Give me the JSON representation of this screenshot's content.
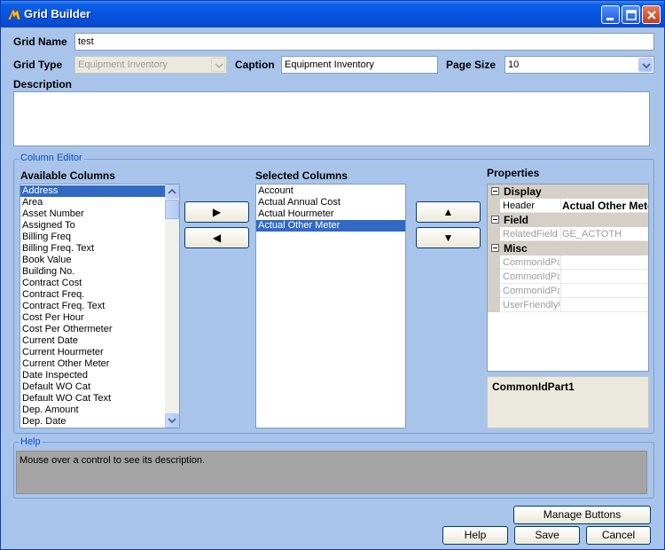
{
  "window": {
    "title": "Grid Builder"
  },
  "form": {
    "grid_name_label": "Grid Name",
    "grid_name_value": "test",
    "grid_type_label": "Grid Type",
    "grid_type_value": "Equipment Inventory",
    "caption_label": "Caption",
    "caption_value": "Equipment Inventory",
    "page_size_label": "Page Size",
    "page_size_value": "10",
    "description_label": "Description",
    "description_value": ""
  },
  "column_editor": {
    "title": "Column Editor",
    "available_label": "Available Columns",
    "available_columns": [
      "Address",
      "Area",
      "Asset Number",
      "Assigned To",
      "Billing Freq",
      "Billing Freq. Text",
      "Book Value",
      "Building No.",
      "Contract Cost",
      "Contract Freq.",
      "Contract Freq. Text",
      "Cost Per Hour",
      "Cost Per Othermeter",
      "Current Date",
      "Current Hourmeter",
      "Current Other Meter",
      "Date Inspected",
      "Default WO Cat",
      "Default WO Cat Text",
      "Dep. Amount",
      "Dep. Date"
    ],
    "available_selected_index": 0,
    "selected_label": "Selected Columns",
    "selected_columns": [
      "Account",
      "Actual Annual Cost",
      "Actual Hourmeter",
      "Actual Other Meter"
    ],
    "selected_selected_index": 3,
    "add_symbol": "▶",
    "remove_symbol": "◀",
    "up_symbol": "▲",
    "down_symbol": "▼"
  },
  "properties": {
    "label": "Properties",
    "categories": [
      {
        "name": "Display",
        "rows": [
          {
            "name": "Header",
            "value": "Actual Other Meter",
            "dim": false,
            "bold_value": true
          }
        ]
      },
      {
        "name": "Field",
        "rows": [
          {
            "name": "RelatedField",
            "value": "GE_ACTOTH",
            "dim": true,
            "bold_value": false
          }
        ]
      },
      {
        "name": "Misc",
        "rows": [
          {
            "name": "CommonIdPa",
            "value": "",
            "dim": true,
            "bold_value": false
          },
          {
            "name": "CommonIdPa",
            "value": "",
            "dim": true,
            "bold_value": false
          },
          {
            "name": "CommonIdPa",
            "value": "",
            "dim": true,
            "bold_value": false
          },
          {
            "name": "UserFriendlyU",
            "value": "",
            "dim": true,
            "bold_value": false
          }
        ]
      }
    ],
    "description_title": "CommonIdPart1"
  },
  "help": {
    "title": "Help",
    "text": "Mouse over a control to see its description."
  },
  "buttons": {
    "manage": "Manage Buttons",
    "help": "Help",
    "save": "Save",
    "cancel": "Cancel"
  },
  "colors": {
    "selection": "#316ac5",
    "dialog_bg": "#a9c4ea",
    "titlebar": "#0553df"
  }
}
